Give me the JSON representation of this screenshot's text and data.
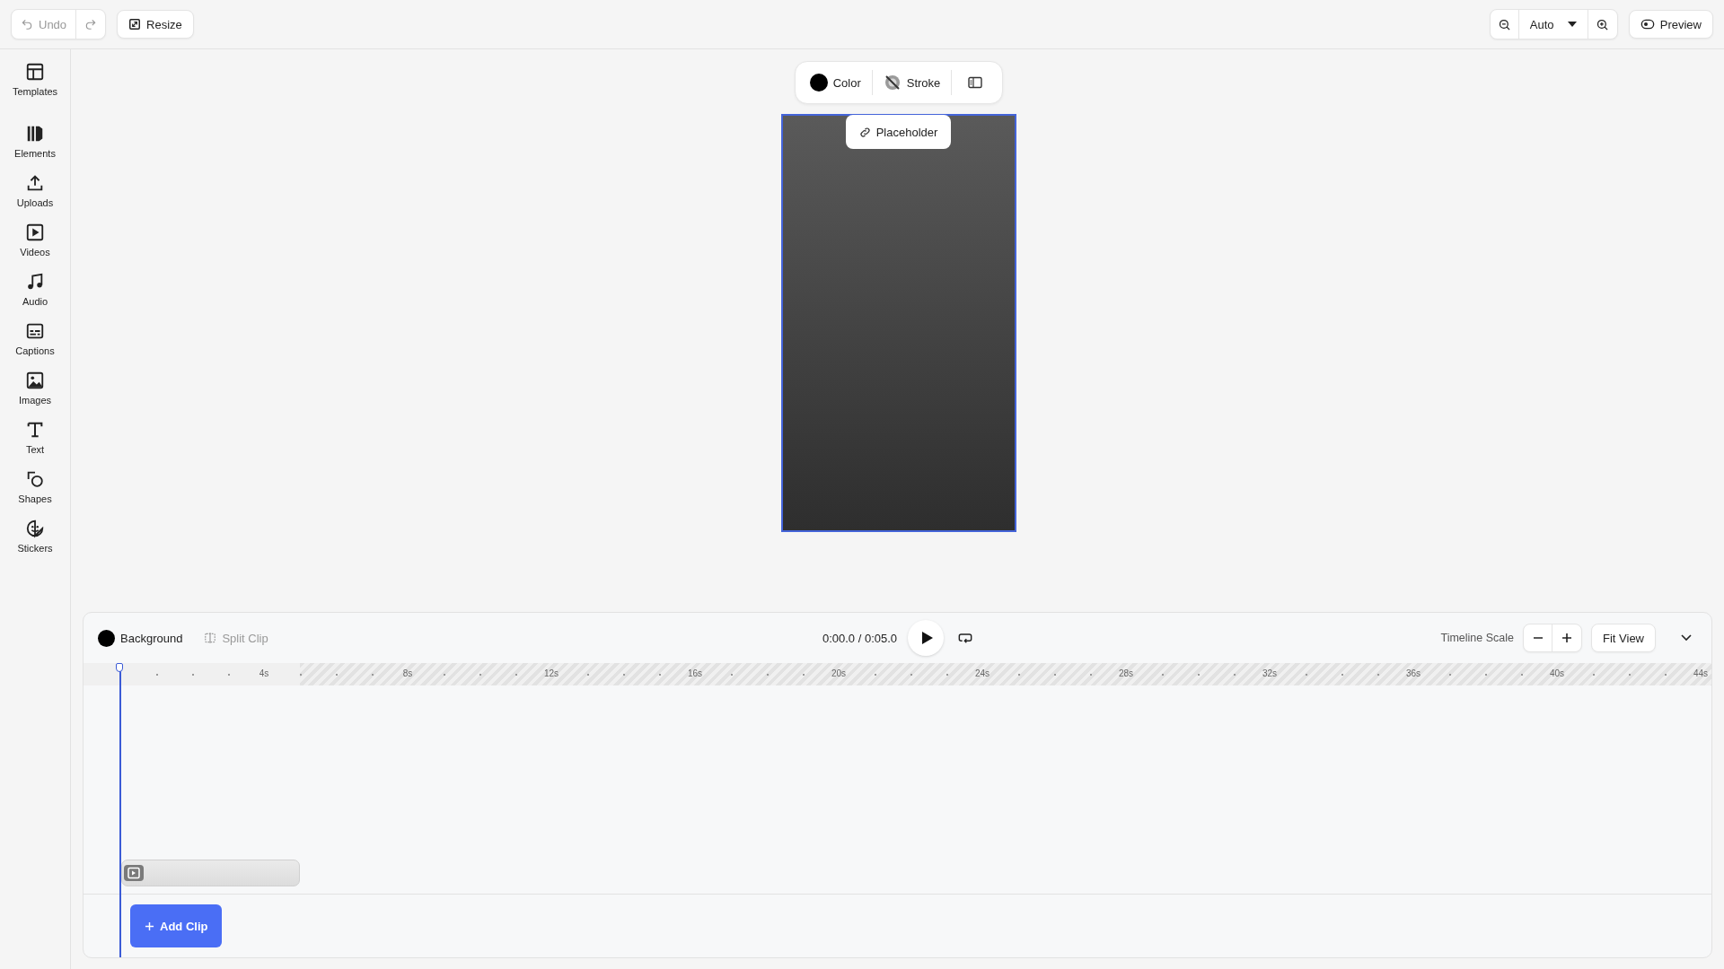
{
  "topbar": {
    "undo": {
      "label": "Undo",
      "disabled": true
    },
    "redo": {
      "disabled": true
    },
    "resize": {
      "label": "Resize"
    },
    "zoom": {
      "value": "Auto"
    },
    "preview": {
      "label": "Preview"
    }
  },
  "sidebar": {
    "items": [
      {
        "label": "Templates",
        "kind": "templates"
      },
      {
        "label": "Elements",
        "kind": "elements"
      },
      {
        "label": "Uploads",
        "kind": "uploads"
      },
      {
        "label": "Videos",
        "kind": "videos"
      },
      {
        "label": "Audio",
        "kind": "audio"
      },
      {
        "label": "Captions",
        "kind": "captions"
      },
      {
        "label": "Images",
        "kind": "images"
      },
      {
        "label": "Text",
        "kind": "text"
      },
      {
        "label": "Shapes",
        "kind": "shapes"
      },
      {
        "label": "Stickers",
        "kind": "stickers"
      }
    ]
  },
  "canvas_toolbar": {
    "color": {
      "label": "Color",
      "color": "#000000"
    },
    "stroke": {
      "label": "Stroke"
    }
  },
  "canvas": {
    "placeholder_chip": "Placeholder"
  },
  "timeline": {
    "background": {
      "label": "Background",
      "color": "#000000"
    },
    "split_clip": {
      "label": "Split Clip",
      "disabled": true
    },
    "time": "0:00.0 / 0:05.0",
    "scale_label": "Timeline Scale",
    "fit_view": "Fit View",
    "ruler_labels": [
      "4s",
      "8s",
      "12s",
      "16s",
      "20s",
      "24s",
      "28s",
      "32s",
      "36s",
      "40s",
      "44s"
    ],
    "add_clip": "Add Clip"
  }
}
